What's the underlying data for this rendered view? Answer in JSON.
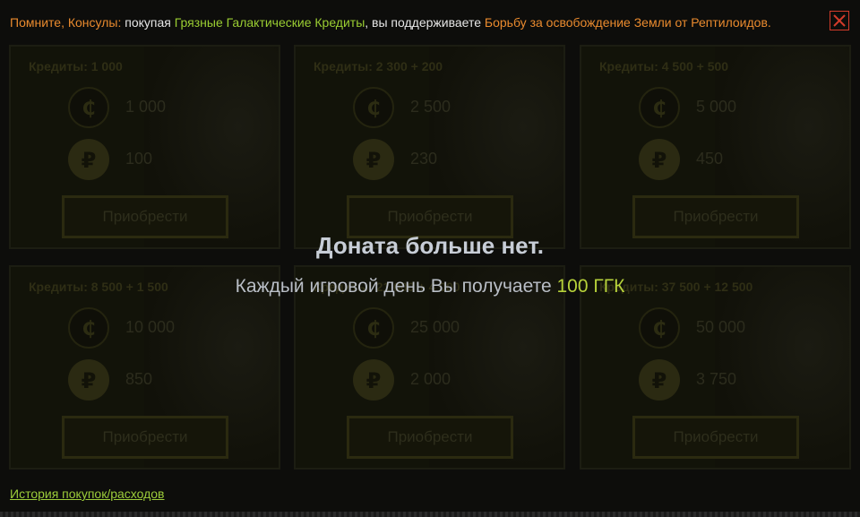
{
  "notice": {
    "part1": "Помните, Консулы:",
    "part2": " покупая ",
    "part3": "Грязные Галактические Кредиты",
    "part4": ", вы поддерживаете ",
    "part5": "Борьбу за освобождение Земли от Рептилоидов."
  },
  "close_label": "×",
  "buy_label": "Приобрести",
  "packages": [
    {
      "title": "Кредиты: 1 000",
      "credits": "1 000",
      "rubles": "100"
    },
    {
      "title": "Кредиты: 2 300 + 200",
      "credits": "2 500",
      "rubles": "230"
    },
    {
      "title": "Кредиты: 4 500 + 500",
      "credits": "5 000",
      "rubles": "450"
    },
    {
      "title": "Кредиты: 8 500 + 1 500",
      "credits": "10 000",
      "rubles": "850"
    },
    {
      "title": "Кредиты: 21 000 + 4 000",
      "credits": "25 000",
      "rubles": "2 000"
    },
    {
      "title": "Кредиты: 37 500 + 12 500",
      "credits": "50 000",
      "rubles": "3 750"
    }
  ],
  "overlay": {
    "title": "Доната больше нет.",
    "subtitle": "Каждый игровой день Вы получаете ",
    "highlight": "100 ГГК"
  },
  "history_link": "История покупок/расходов",
  "colors": {
    "accent_orange": "#e98a2e",
    "accent_green": "#9acd32",
    "close_red": "#d23b2a"
  }
}
